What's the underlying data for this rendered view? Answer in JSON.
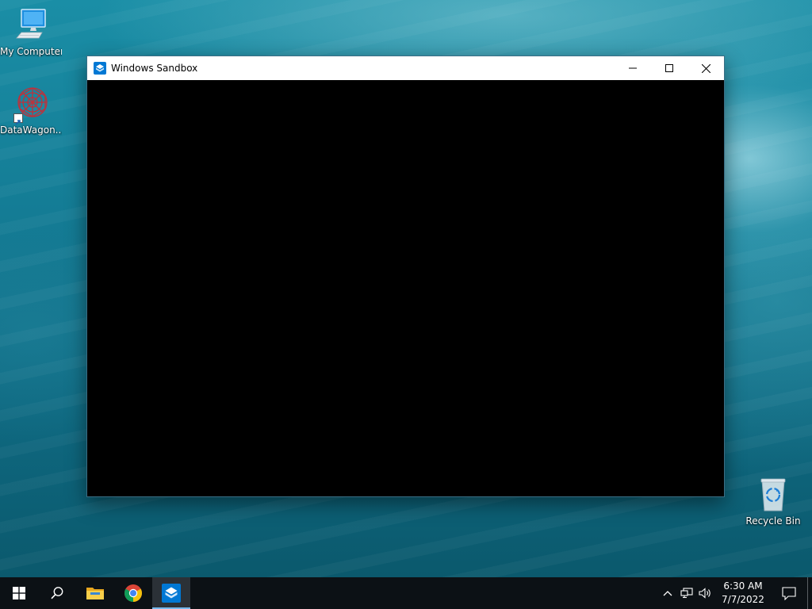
{
  "desktop": {
    "icons": [
      {
        "label": "My Computer",
        "icon": "monitor-icon"
      },
      {
        "label": "DataWagon...",
        "icon": "datawagon-logo-icon"
      },
      {
        "label": "Recycle Bin",
        "icon": "recycle-bin-icon"
      }
    ]
  },
  "window": {
    "title": "Windows Sandbox",
    "icon": "sandbox-icon",
    "controls": [
      "minimize",
      "maximize",
      "close"
    ]
  },
  "taskbar": {
    "buttons": [
      {
        "name": "start",
        "icon": "windows-logo-icon"
      },
      {
        "name": "search",
        "icon": "search-icon"
      },
      {
        "name": "file-explorer",
        "icon": "folder-icon"
      },
      {
        "name": "chrome",
        "icon": "chrome-icon"
      },
      {
        "name": "windows-sandbox",
        "icon": "sandbox-icon",
        "active": true
      }
    ],
    "tray": {
      "icons": [
        "chevron-up-icon",
        "network-icon",
        "volume-icon"
      ],
      "time": "6:30 AM",
      "date": "7/7/2022"
    }
  },
  "colors": {
    "taskbar_bg": "#0c1115",
    "active_indicator": "#76b9ed",
    "sandbox_blue": "#0078d4",
    "window_client": "#000000"
  }
}
